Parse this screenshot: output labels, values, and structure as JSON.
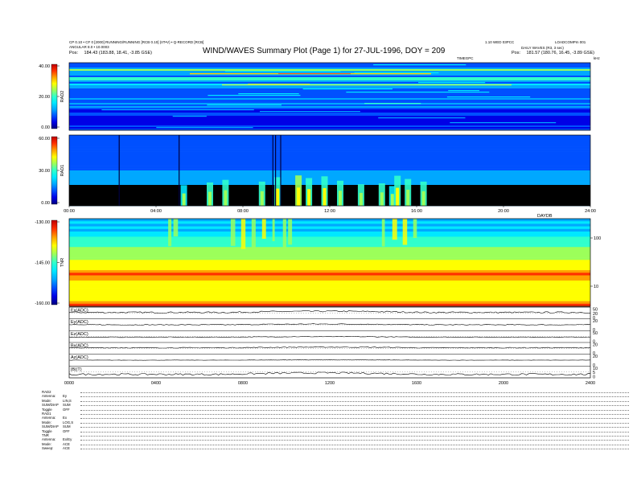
{
  "header": {
    "left_line1": "CP 0.10 • CF 0 [2000] RUNNING/RUNNING [RCB 0.10] (IIT•V) • Q-RECORD [RCB]",
    "left_line2": "ANGULAR 8.0 • 10.0003",
    "left_pos_label": "Pos:",
    "left_pos_value": "184.43 (183.88, 18.41, -3.85 GSE)",
    "title": "WIND/WAVES Summary Plot (Page 1) for 27-JUL-1996, DOY = 209",
    "right_line1": "1.10 WED 03PCC",
    "right_line2": "LOADCOMPm 001",
    "right_line3": "DAILY WAVES (R3, 3 sec)",
    "right_pos_label": "Pos:",
    "right_pos_value": "181.57 (180.76, 16.45, -3.89 GSE)",
    "center_small": "TIMEGPC",
    "right_small": "kHz"
  },
  "colors": {
    "cmap": [
      "#000080",
      "#0000e6",
      "#0050ff",
      "#00a8ff",
      "#00e8ff",
      "#30ffcc",
      "#9cff5a",
      "#ffff00",
      "#ffa000",
      "#ff3000",
      "#c00000"
    ]
  },
  "chart_data": [
    {
      "type": "heatmap",
      "panel": "RAD2",
      "ylabel": "RAD2",
      "y_ticks": [
        "40.00",
        "20.00",
        "0.00"
      ],
      "ylim": [
        0,
        40
      ],
      "xlim_hours": [
        0,
        24
      ],
      "colorbar": true
    },
    {
      "type": "heatmap",
      "panel": "RAD1",
      "ylabel": "RAD1",
      "y_ticks": [
        "60.00",
        "30.00",
        "0.00"
      ],
      "ylim": [
        0,
        60
      ],
      "x_ticks": [
        "00:00",
        "04:00",
        "08:00",
        "12:00",
        "16:00",
        "20:00",
        "24:00"
      ],
      "x_unit_label": "DAYDB",
      "xlim_hours": [
        0,
        24
      ],
      "colorbar": true
    },
    {
      "type": "heatmap",
      "panel": "TNR",
      "ylabel": "TNR",
      "y_ticks": [
        "-130.00",
        "-145.00",
        "-160.00"
      ],
      "ylim": [
        -160,
        -130
      ],
      "right_ticks": [
        "100",
        "10"
      ],
      "xlim_hours": [
        0,
        24
      ],
      "colorbar": true
    },
    {
      "type": "line",
      "panel": "traces",
      "x_ticks": [
        "0000",
        "0400",
        "0800",
        "1200",
        "1600",
        "2000",
        "2400"
      ],
      "xlim_hours": [
        0,
        24
      ],
      "series": [
        {
          "name": "Ex(ADC)",
          "right_ticks": [
            "50",
            "20",
            "0"
          ],
          "baseline": 0.55,
          "jitter": 0.12
        },
        {
          "name": "Ey(ADC)",
          "right_ticks": [
            "20",
            "0"
          ],
          "baseline": 0.5,
          "jitter": 0.08
        },
        {
          "name": "Ez(ADC)",
          "right_ticks": [
            "50",
            "0"
          ],
          "baseline": 0.45,
          "jitter": 0.06
        },
        {
          "name": "Bx(ADC)",
          "right_ticks": [
            "20",
            "0"
          ],
          "baseline": 0.55,
          "jitter": 0.07
        },
        {
          "name": "Az(ADC)",
          "right_ticks": [
            "20",
            "0"
          ],
          "baseline": 0.5,
          "jitter": 0.03
        },
        {
          "name": "|B|(T)",
          "right_ticks": [
            "10",
            "5",
            "0"
          ],
          "baseline": 0.3,
          "jitter": 0.15
        }
      ]
    }
  ],
  "footer": {
    "rows": [
      {
        "k": "RAD2",
        "v": ""
      },
      {
        "k": "Antenna:",
        "v": "Ey"
      },
      {
        "k": "Mode:",
        "v": "LIN,S"
      },
      {
        "k": "SUM/DIAP",
        "v": "SUM"
      },
      {
        "k": "Toggle",
        "v": "OFF"
      },
      {
        "k": "RAD1",
        "v": ""
      },
      {
        "k": "Antenna:",
        "v": "Ex"
      },
      {
        "k": "Mode:",
        "v": "LOG,S"
      },
      {
        "k": "SUM/DIAP",
        "v": "SUM"
      },
      {
        "k": "Toggle",
        "v": "OFF"
      },
      {
        "k": "TNR",
        "v": ""
      },
      {
        "k": "Antenna:",
        "v": "Ex/Ey"
      },
      {
        "k": "Mode:",
        "v": "ACE"
      },
      {
        "k": "Sweep:",
        "v": "ACE"
      }
    ]
  }
}
